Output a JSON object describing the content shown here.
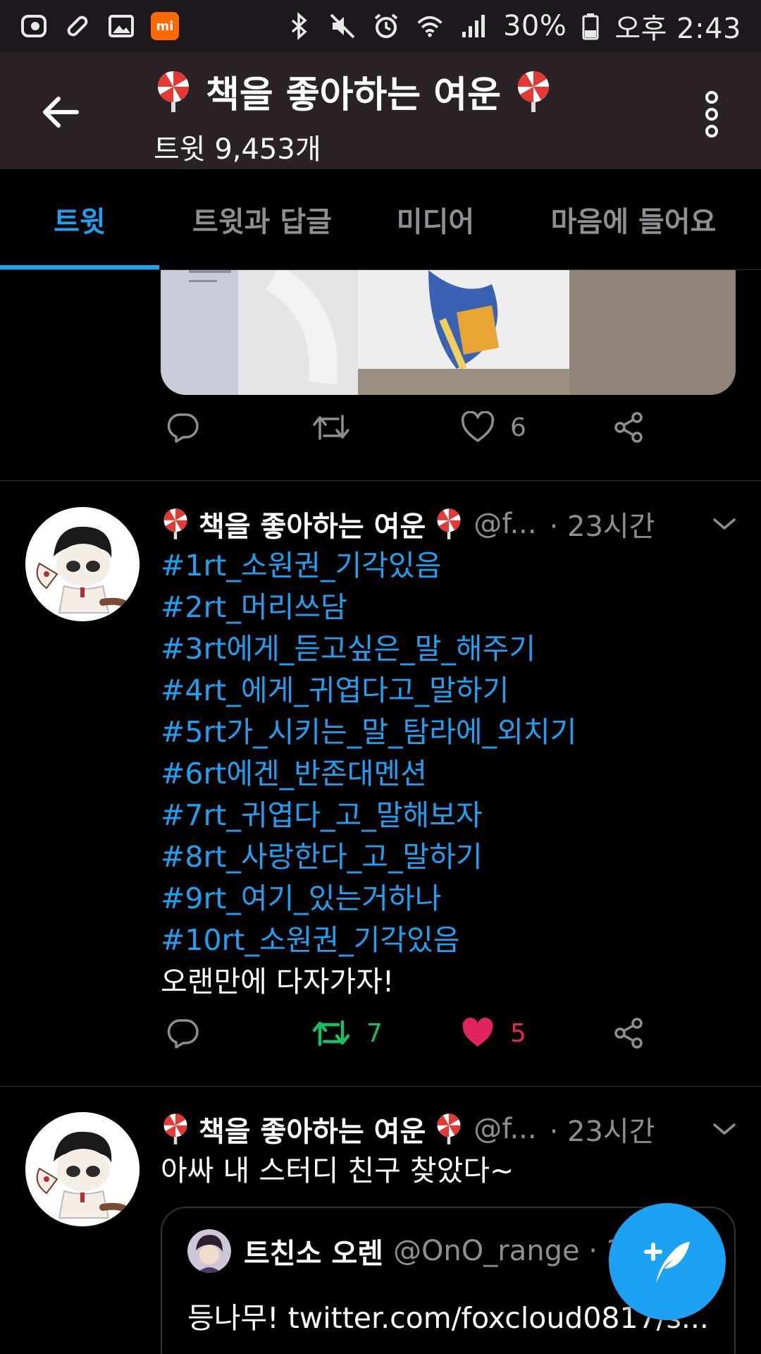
{
  "status_bar": {
    "battery": "30%",
    "ampm": "오후",
    "time": "2:43",
    "left_icons": [
      "app-icon",
      "pill-icon",
      "gallery-icon",
      "mi-icon"
    ],
    "mi_label": "mi",
    "right_icons": [
      "bluetooth-icon",
      "mute-icon",
      "alarm-icon",
      "wifi-icon",
      "signal-icon",
      "battery-icon"
    ]
  },
  "header": {
    "title": "책을 좋아하는 여운",
    "subtitle": "트윗 9,453개"
  },
  "tabs": [
    {
      "label": "트윗",
      "active": true
    },
    {
      "label": "트윗과 답글",
      "active": false
    },
    {
      "label": "미디어",
      "active": false
    },
    {
      "label": "마음에 들어요",
      "active": false
    }
  ],
  "tweet0": {
    "like_count": "6"
  },
  "tweet1": {
    "name": "책을 좋아하는 여운",
    "handle": "@f...",
    "time": "· 23시간",
    "hashtags": [
      "#1rt_소원권_기각있음",
      "#2rt_머리쓰담",
      "#3rt에게_듣고싶은_말_해주기",
      "#4rt_에게_귀엽다고_말하기",
      "#5rt가_시키는_말_탐라에_외치기",
      "#6rt에겐_반존대멘션",
      "#7rt_귀엽다_고_말해보자",
      "#8rt_사랑한다_고_말하기",
      "#9rt_여기_있는거하나",
      "#10rt_소원권_기각있음"
    ],
    "closing": "오랜만에 다자가자!",
    "retweet_count": "7",
    "like_count": "5"
  },
  "tweet2": {
    "name": "책을 좋아하는 여운",
    "handle": "@f...",
    "time": "· 23시간",
    "text": "아싸 내 스터디 친구 찾았다~",
    "quote": {
      "name": "트친소 오렌",
      "handle": "@OnO_range · 2",
      "text": "등나무! twitter.com/foxcloud0817/s..."
    }
  },
  "colors": {
    "accent": "#1da1f2",
    "retweet": "#17bf63",
    "like": "#e0245e",
    "header_bg": "#2a2225",
    "statusbar_bg": "#1c181d"
  }
}
